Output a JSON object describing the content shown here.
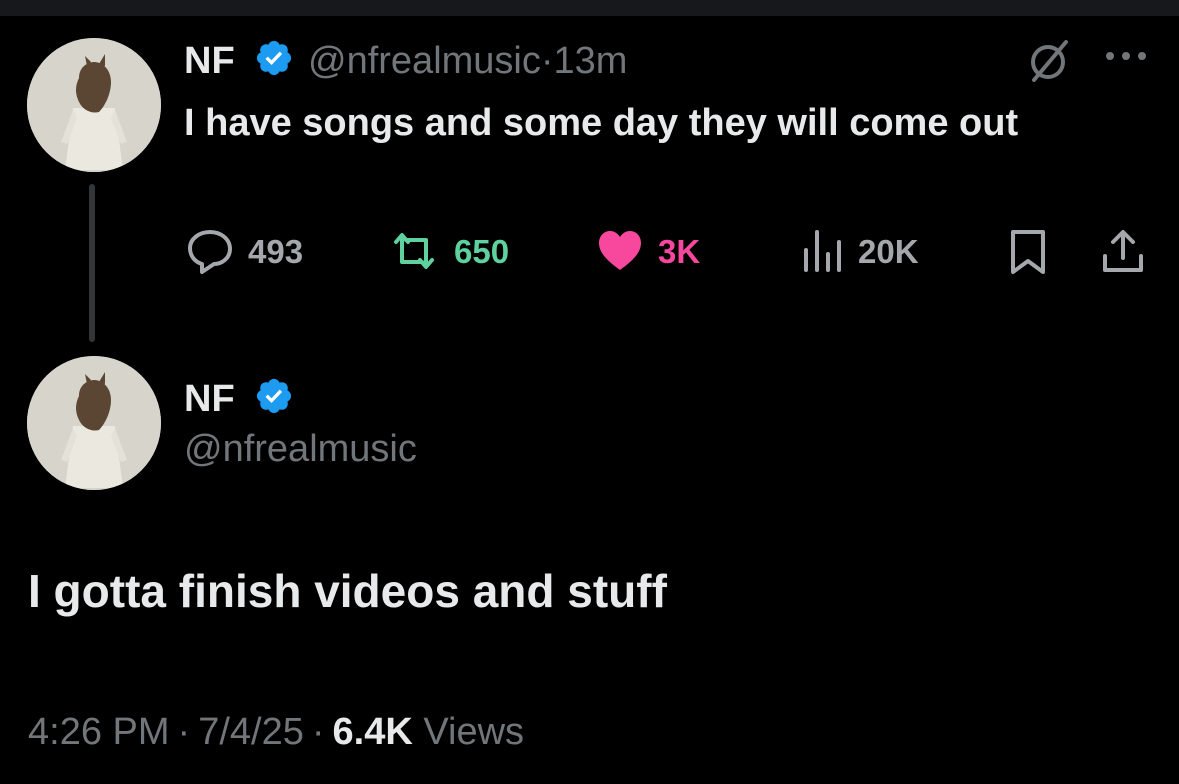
{
  "colors": {
    "background": "#000000",
    "text": "#e7e9ea",
    "muted": "#71767b",
    "verified": "#1d9bf0",
    "retweet": "#5fd19e",
    "like": "#f7489d"
  },
  "reply_tweet": {
    "author_name": "NF",
    "author_handle": "@nfrealmusic",
    "separator": "·",
    "time_ago": "13m",
    "text": "I have songs and some day they will come out",
    "actions": {
      "replies": "493",
      "retweets": "650",
      "likes": "3K",
      "views": "20K"
    },
    "icons": [
      "grok-icon",
      "more-icon",
      "reply-icon",
      "retweet-icon",
      "heart-icon",
      "views-icon",
      "bookmark-icon",
      "share-icon"
    ]
  },
  "main_tweet": {
    "author_name": "NF",
    "author_handle": "@nfrealmusic",
    "text": "I gotta finish videos and stuff",
    "time": "4:26 PM",
    "date": "7/4/25",
    "separator": "·",
    "views_count": "6.4K",
    "views_label": "Views"
  }
}
